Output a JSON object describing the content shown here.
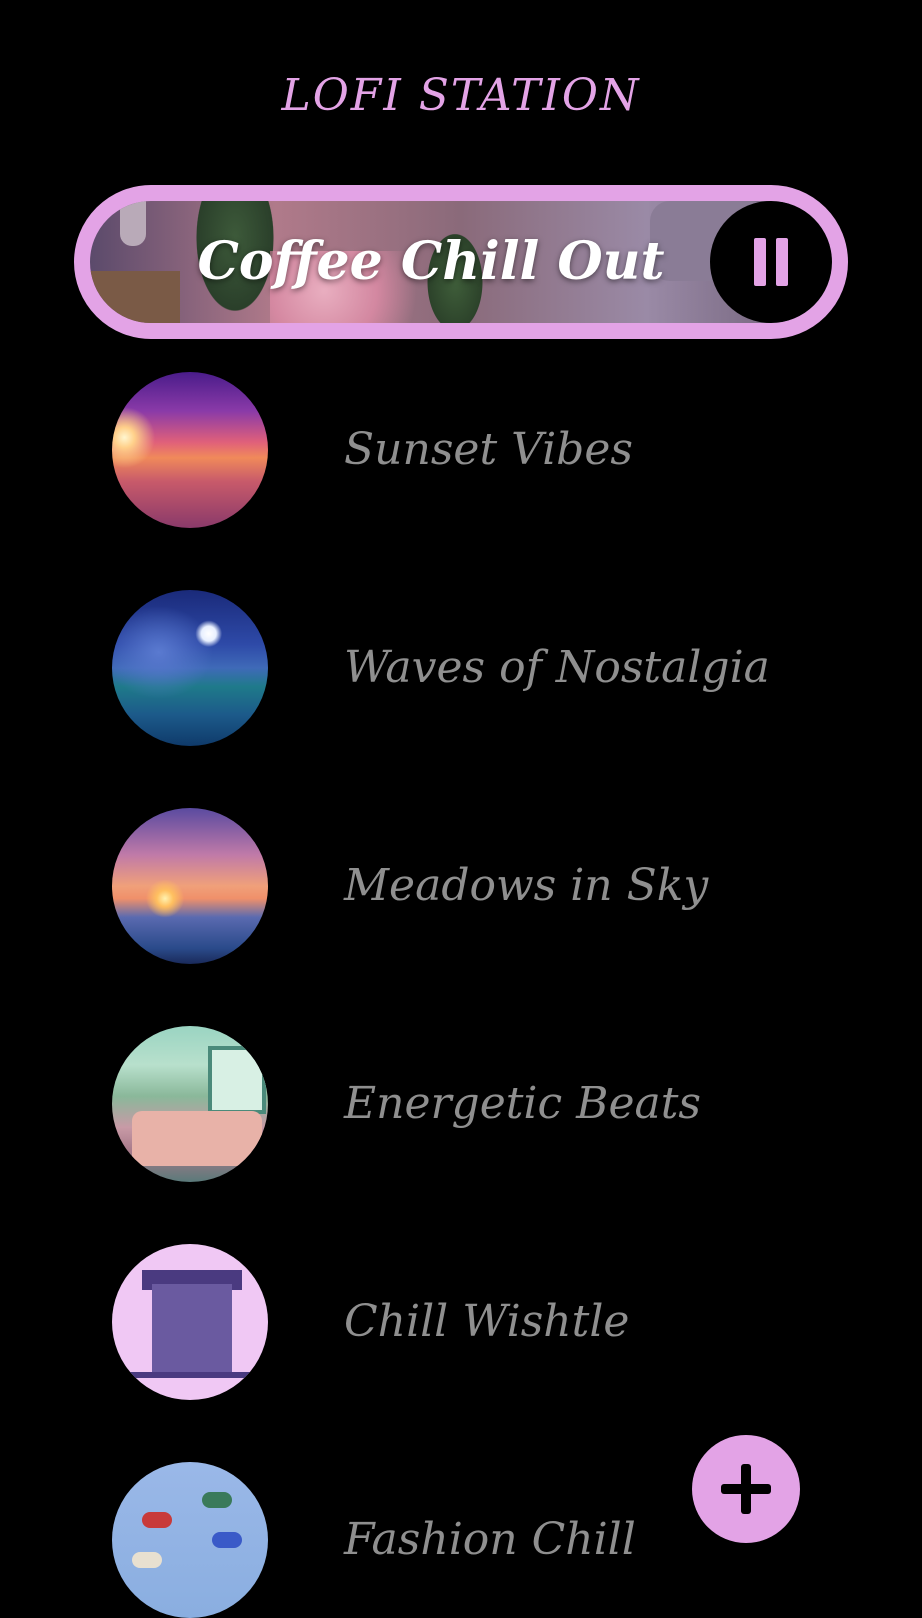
{
  "app": {
    "title": "LOFI STATION"
  },
  "now_playing": {
    "title": "Coffee Chill Out",
    "state": "playing",
    "control_icon": "pause-icon"
  },
  "stations": [
    {
      "label": "Sunset Vibes",
      "art": "sunset-artwork"
    },
    {
      "label": "Waves of Nostalgia",
      "art": "ocean-night-artwork"
    },
    {
      "label": "Meadows in Sky",
      "art": "sea-sunset-artwork"
    },
    {
      "label": "Energetic Beats",
      "art": "bedroom-plants-artwork"
    },
    {
      "label": "Chill Wishtle",
      "art": "pixel-house-artwork"
    },
    {
      "label": "Fashion Chill",
      "art": "shoes-artwork"
    }
  ],
  "fab": {
    "icon": "plus-icon"
  },
  "colors": {
    "background": "#000000",
    "accent": "#e3a3e6",
    "station_text": "#8f8f8f",
    "now_playing_text": "#ffffff"
  }
}
